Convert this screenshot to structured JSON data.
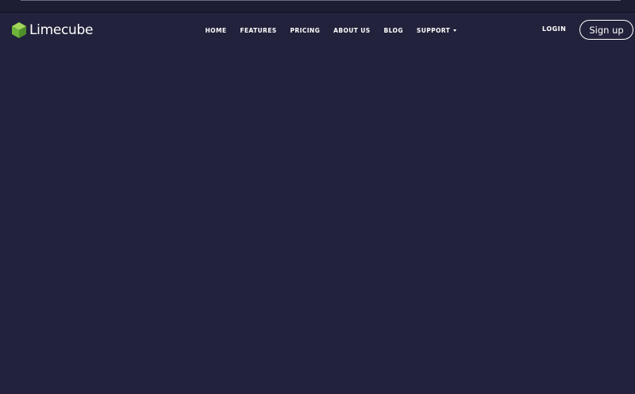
{
  "brand": {
    "name": "Limecube",
    "logo_icon": "cube-icon",
    "accent_color": "#7dc242"
  },
  "nav": {
    "items": [
      {
        "label": "HOME"
      },
      {
        "label": "FEATURES"
      },
      {
        "label": "PRICING"
      },
      {
        "label": "ABOUT US"
      },
      {
        "label": "BLOG"
      },
      {
        "label": "SUPPORT",
        "dropdown_icon": "caret-down-icon"
      }
    ]
  },
  "auth": {
    "login_label": "LOGIN",
    "signup_label": "Sign up"
  },
  "theme": {
    "background": "#22223c",
    "text": "#ffffff"
  }
}
